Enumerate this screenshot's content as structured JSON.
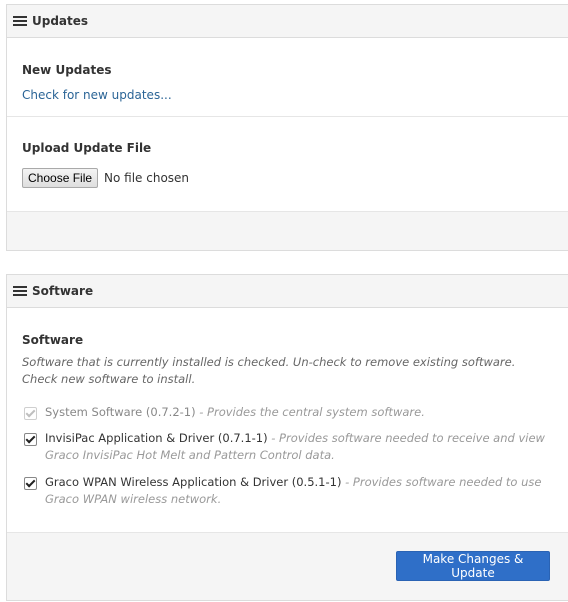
{
  "updates_panel": {
    "title": "Updates",
    "new_updates_label": "New Updates",
    "check_link": "Check for new updates...",
    "upload_label": "Upload Update File",
    "choose_file_button": "Choose File",
    "file_status": "No file chosen"
  },
  "software_panel": {
    "title": "Software",
    "section_label": "Software",
    "help_text": "Software that is currently installed is checked. Un-check to remove existing software. Check new software to install.",
    "items": [
      {
        "name": "System Software (0.7.2-1)",
        "description": "- Provides the central system software.",
        "checked": true,
        "disabled": true
      },
      {
        "name": "InvisiPac Application & Driver (0.7.1-1)",
        "description": "- Provides software needed to receive and view Graco InvisiPac Hot Melt and Pattern Control data.",
        "checked": true,
        "disabled": false
      },
      {
        "name": "Graco WPAN Wireless Application & Driver (0.5.1-1)",
        "description": "- Provides software needed to use Graco WPAN wireless network.",
        "checked": true,
        "disabled": false
      }
    ],
    "submit_button": "Make Changes & Update"
  }
}
